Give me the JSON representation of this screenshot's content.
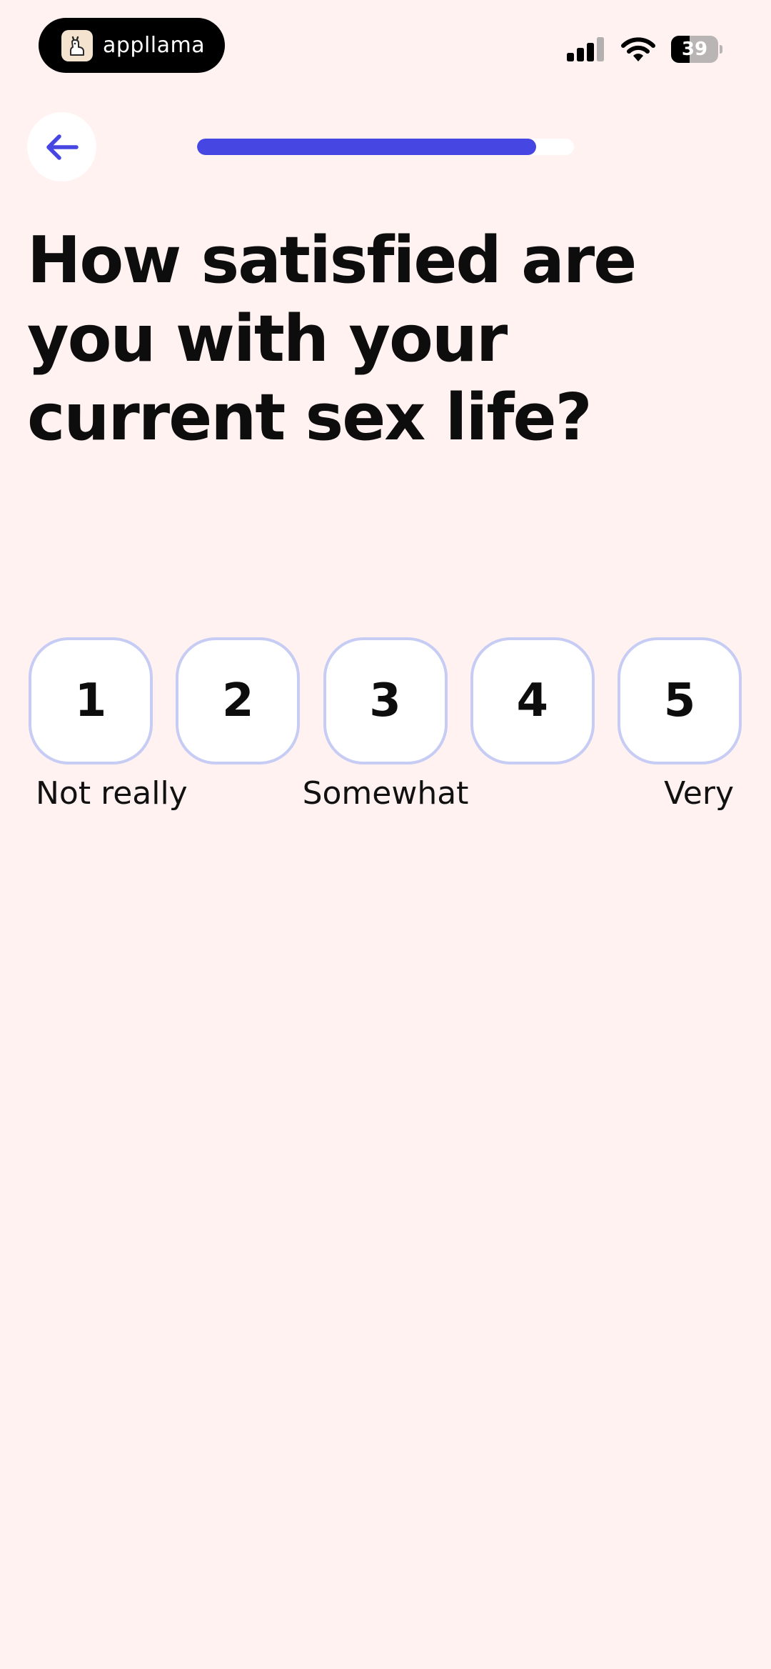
{
  "status_bar": {
    "app_name": "appllama",
    "battery_level": "39",
    "battery_percent": 39
  },
  "header": {
    "back_icon": "arrow-left-icon",
    "progress_fraction": 0.9
  },
  "question": {
    "title": "How satisfied are you with your current sex life?"
  },
  "rating": {
    "options": [
      "1",
      "2",
      "3",
      "4",
      "5"
    ],
    "labels": {
      "low": "Not really",
      "mid": "Somewhat",
      "high": "Very"
    }
  },
  "colors": {
    "background": "#FFF2F1",
    "accent": "#4646E2",
    "option_border": "#C6CCF3"
  }
}
